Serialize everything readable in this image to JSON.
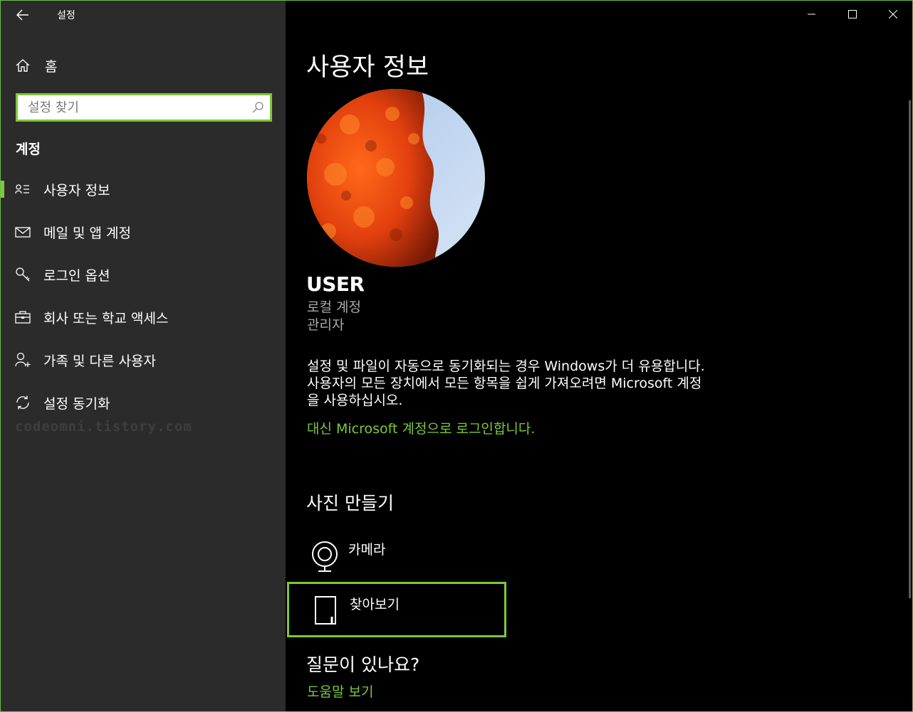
{
  "window": {
    "app_title": "설정",
    "controls": [
      "minimize-icon",
      "maximize-icon",
      "close-icon"
    ]
  },
  "sidebar": {
    "home_label": "홈",
    "search": {
      "placeholder": "설정 찾기"
    },
    "section_title": "계정",
    "items": [
      {
        "label": "사용자 정보",
        "icon": "user-info-icon",
        "active": true
      },
      {
        "label": "메일 및 앱 계정",
        "icon": "mail-icon",
        "active": false
      },
      {
        "label": "로그인 옵션",
        "icon": "key-icon",
        "active": false
      },
      {
        "label": "회사 또는 학교 액세스",
        "icon": "briefcase-icon",
        "active": false
      },
      {
        "label": "가족 및 다른 사용자",
        "icon": "add-user-icon",
        "active": false
      },
      {
        "label": "설정 동기화",
        "icon": "sync-icon",
        "active": false
      }
    ],
    "watermark": "codeomni.tistory.com"
  },
  "main": {
    "title": "사용자 정보",
    "user": {
      "name": "USER",
      "account_type": "로컬 계정",
      "role": "관리자"
    },
    "info_text": "설정 및 파일이 자동으로 동기화되는 경우 Windows가 더 유용합니다. 사용자의 모든 장치에서 모든 항목을 쉽게 가져오려면 Microsoft 계정을 사용하십시오.",
    "ms_signin_link": "대신 Microsoft 계정으로 로그인합니다.",
    "create_photo": {
      "title": "사진 만들기",
      "camera_label": "카메라",
      "browse_label": "찾아보기"
    },
    "questions": {
      "title": "질문이 있나요?",
      "help_link": "도움말 보기"
    }
  },
  "colors": {
    "accent": "#7cc83a",
    "sidebar_bg": "#2b2b2b",
    "main_bg": "#000000",
    "secondary_text": "#a8a8a8"
  }
}
